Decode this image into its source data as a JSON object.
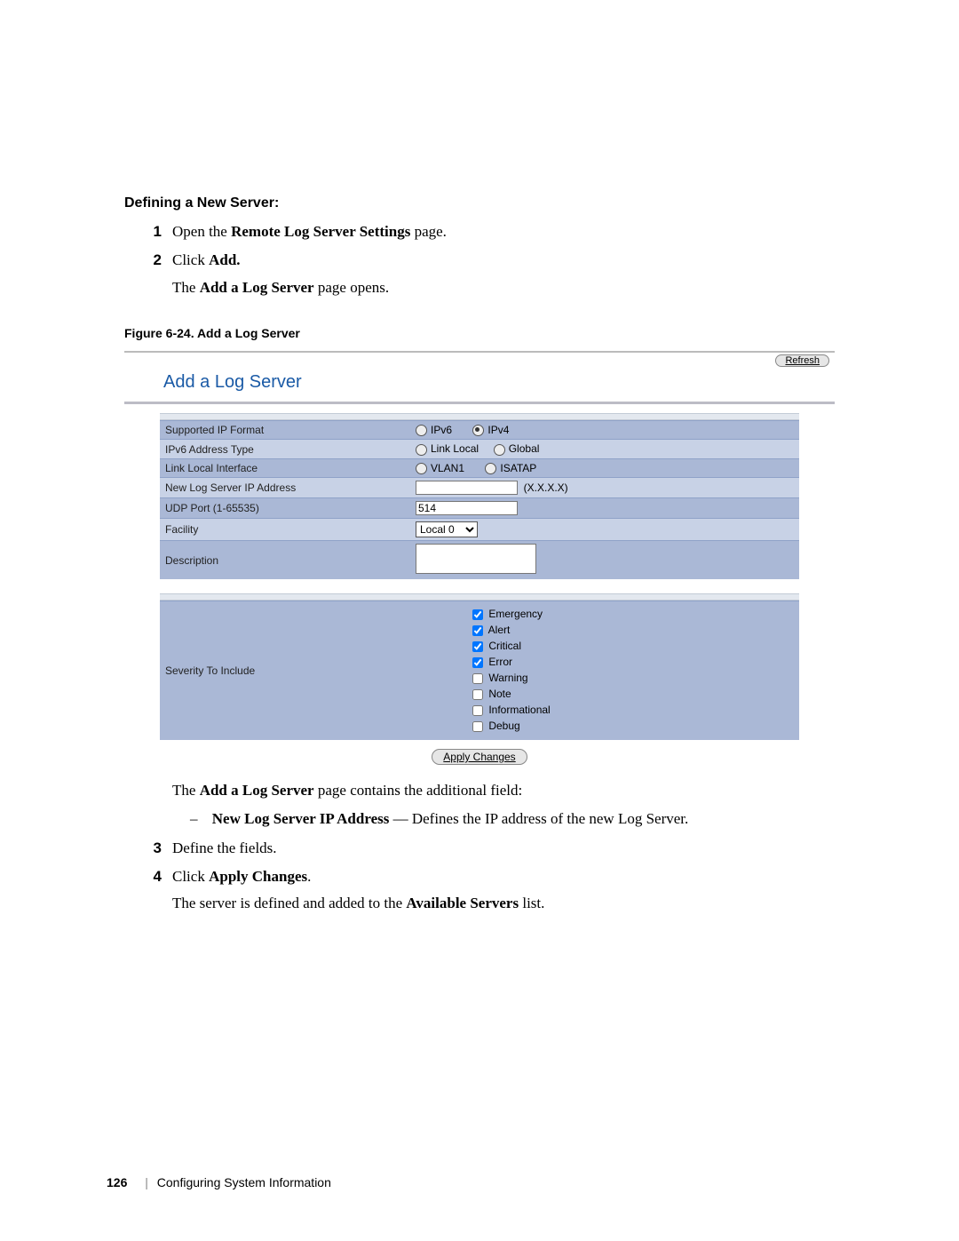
{
  "heading": "Defining a New Server:",
  "steps": {
    "s1a": "Open the ",
    "s1b": "Remote Log Server Settings",
    "s1c": " page.",
    "s2a": "Click ",
    "s2b": "Add.",
    "s2c": "The ",
    "s2d": "Add a Log Server",
    "s2e": " page opens."
  },
  "figcap": "Figure 6-24.    Add a Log Server",
  "panel": {
    "refresh": "Refresh",
    "title": "Add a Log Server",
    "rows": {
      "supported": "Supported IP Format",
      "ipv6": "IPv6",
      "ipv4": "IPv4",
      "addr_type": "IPv6 Address Type",
      "linklocal": "Link Local",
      "global": "Global",
      "ll_iface": "Link Local Interface",
      "vlan1": "VLAN1",
      "isatap": "ISATAP",
      "newip": "New Log Server IP Address",
      "newip_hint": "(X.X.X.X)",
      "udp": "UDP Port (1-65535)",
      "udp_val": "514",
      "facility": "Facility",
      "facility_val": "Local 0",
      "desc": "Description"
    },
    "sev_label": "Severity To Include",
    "sev": {
      "emergency": "Emergency",
      "alert": "Alert",
      "critical": "Critical",
      "error": "Error",
      "warning": "Warning",
      "note": "Note",
      "informational": "Informational",
      "debug": "Debug"
    },
    "apply": "Apply Changes"
  },
  "after": {
    "a1a": "The ",
    "a1b": "Add a Log Server",
    "a1c": " page contains the additional field:",
    "a2a": "New Log Server IP Address",
    "a2b": " — Defines the IP address of the new Log Server.",
    "s3": "Define the fields.",
    "s4a": "Click ",
    "s4b": "Apply Changes",
    "s4c": ".",
    "s4d": "The server is defined and added to the ",
    "s4e": "Available Servers",
    "s4f": " list."
  },
  "footer": {
    "page": "126",
    "section": "Configuring System Information"
  }
}
